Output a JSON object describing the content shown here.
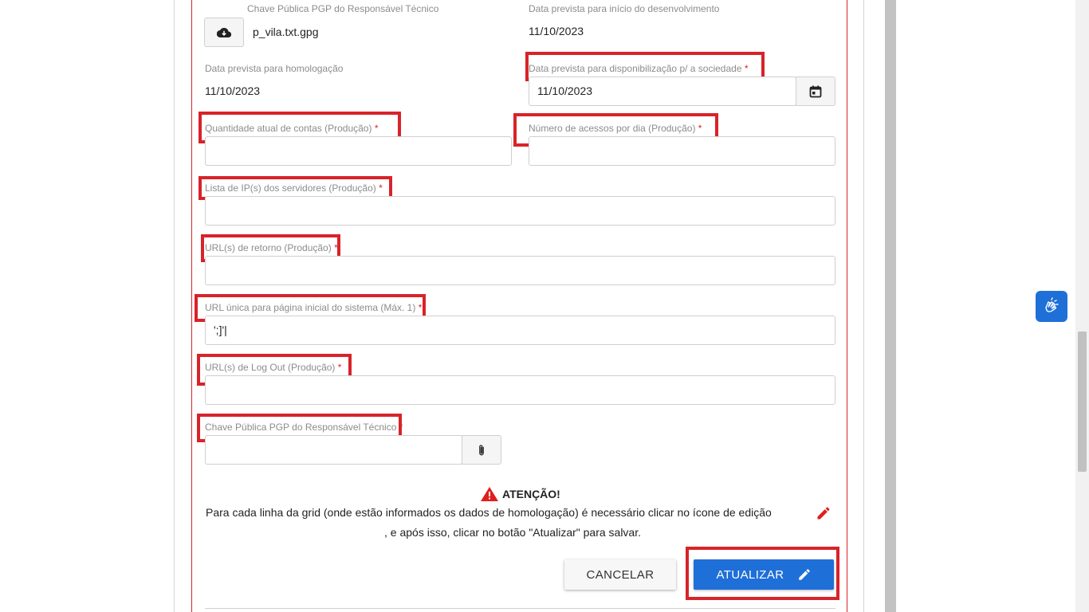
{
  "top": {
    "pgp_label": "Chave Pública PGP do Responsável Técnico",
    "pgp_file": "p_vila.txt.gpg",
    "start_dev_label": "Data prevista para início do desenvolvimento",
    "start_dev_value": "11/10/2023"
  },
  "homolog": {
    "label": "Data prevista para homologação",
    "value": "11/10/2023"
  },
  "availability": {
    "label": "Data prevista para disponibilização p/ a sociedade",
    "value": "11/10/2023"
  },
  "accounts": {
    "label": "Quantidade atual de contas (Produção)",
    "value": ""
  },
  "daily_access": {
    "label": "Número de acessos por dia (Produção)",
    "value": ""
  },
  "ip_list": {
    "label": "Lista de IP(s) dos servidores (Produção)",
    "value": ""
  },
  "return_urls": {
    "label": "URL(s) de retorno (Produção)",
    "value": ""
  },
  "home_url": {
    "label": "URL única para página inicial do sistema (Máx. 1)",
    "value": "';]'|"
  },
  "logout_urls": {
    "label": "URL(s) de Log Out (Produção)",
    "value": ""
  },
  "pgp_key": {
    "label": "Chave Pública PGP do Responsável Técnico",
    "value": ""
  },
  "required_mark": "*",
  "warning": {
    "title": "ATENÇÃO!",
    "line1": "Para cada linha da grid (onde estão informados os dados de homologação) é necessário clicar no ícone de edição",
    "line2": ", e após isso, clicar no botão \"Atualizar\" para salvar."
  },
  "buttons": {
    "cancel": "CANCELAR",
    "update": "ATUALIZAR"
  },
  "icons": {
    "download": "cloud-download-icon",
    "calendar": "calendar-icon",
    "attach": "paperclip-icon",
    "warning": "warning-triangle-icon",
    "edit": "pencil-icon",
    "accessibility": "sign-language-icon"
  },
  "colors": {
    "highlight": "#d8232a",
    "primary": "#1f6fd8",
    "warning": "#e01e1e"
  }
}
